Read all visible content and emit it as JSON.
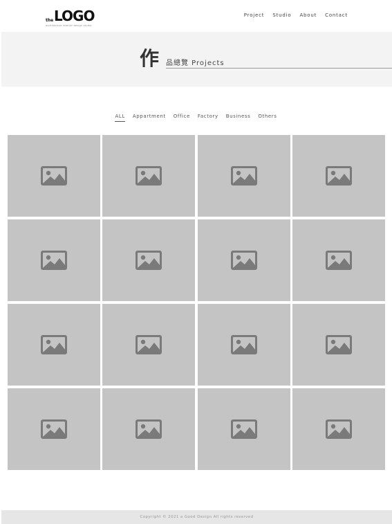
{
  "header": {
    "logo": {
      "prefix": "the",
      "main": "LOGO",
      "tagline": "architecture interior design studio"
    },
    "nav": [
      "Project",
      "Studio",
      "About",
      "Contact"
    ]
  },
  "banner": {
    "char": "作",
    "subtitle": "品總覽 Projects"
  },
  "filters": {
    "items": [
      "ALL",
      "Appartment",
      "Office",
      "Factory",
      "Business",
      "Others"
    ],
    "active": "ALL"
  },
  "grid": {
    "tile_count": 16,
    "placeholder_icon": "image-placeholder-icon",
    "tile_color": "#c4c4c4",
    "icon_color": "#7a7a7a"
  },
  "footer": {
    "text": "Copyright © 2021 a Good Design All rights reserved"
  }
}
